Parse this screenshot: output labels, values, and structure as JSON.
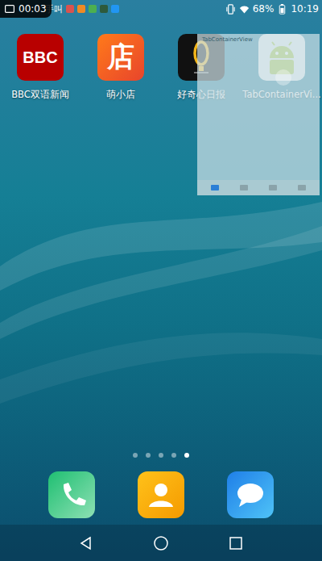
{
  "status_bar": {
    "recording_time": "00:03",
    "carrier_text": "手叫",
    "battery": "68%",
    "time": "10:19"
  },
  "apps": [
    {
      "label": "BBC双语新闻",
      "kind": "bbc",
      "icon_text": "BBC"
    },
    {
      "label": "萌小店",
      "kind": "shop",
      "icon_text": "店"
    },
    {
      "label": "好奇心日报",
      "kind": "qdaily",
      "icon_text": ""
    },
    {
      "label": "TabContainerVi...",
      "kind": "android",
      "icon_text": ""
    }
  ],
  "floating_window": {
    "title": "TabContainerView",
    "tabs": [
      {
        "selected": true
      },
      {
        "selected": false
      },
      {
        "selected": false
      },
      {
        "selected": false
      }
    ]
  },
  "page_dots": [
    {
      "selected": false
    },
    {
      "selected": false
    },
    {
      "selected": false
    },
    {
      "selected": false
    },
    {
      "selected": true
    }
  ],
  "dock": [
    {
      "kind": "phone"
    },
    {
      "kind": "contacts"
    },
    {
      "kind": "messages"
    }
  ]
}
